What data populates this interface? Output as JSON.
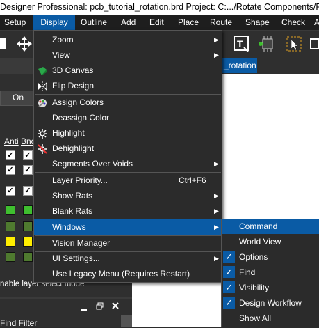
{
  "window": {
    "title": "Designer Professional: pcb_tutorial_rotation.brd  Project: C:.../Rotate Components/PCB F"
  },
  "menubar": {
    "items": [
      "Setup",
      "Display",
      "Outline",
      "Add",
      "Edit",
      "Place",
      "Route",
      "Shape",
      "Check",
      "A"
    ],
    "active": "Display"
  },
  "tabs": {
    "document": "_rotation"
  },
  "left_panel": {
    "on_label": "On",
    "col1": "Anti",
    "col2": "Bnd",
    "enable_layer_text": "nable layer select mode",
    "find_filter": "Find Filter"
  },
  "display_menu": {
    "items": [
      {
        "label": "Zoom",
        "submenu": true
      },
      {
        "label": "View",
        "submenu": true
      },
      {
        "label": "3D Canvas",
        "icon": "3d-canvas-icon"
      },
      {
        "label": "Flip Design",
        "icon": "flip-design-icon"
      },
      {
        "label": "Assign Colors",
        "icon": "assign-colors-icon"
      },
      {
        "label": "Deassign Color"
      },
      {
        "label": "Highlight",
        "icon": "highlight-icon"
      },
      {
        "label": "Dehighlight",
        "icon": "dehighlight-icon"
      },
      {
        "label": "Segments Over Voids",
        "submenu": true
      },
      {
        "label": "Layer Priority...",
        "shortcut": "Ctrl+F6"
      },
      {
        "label": "Show Rats",
        "submenu": true
      },
      {
        "label": "Blank Rats",
        "submenu": true
      },
      {
        "label": "Windows",
        "submenu": true,
        "highlighted": true
      },
      {
        "label": "Vision Manager"
      },
      {
        "label": "UI Settings...",
        "submenu": true
      },
      {
        "label": "Use Legacy Menu (Requires Restart)"
      }
    ]
  },
  "windows_submenu": {
    "items": [
      {
        "label": "Command",
        "checked": false,
        "highlighted": true
      },
      {
        "label": "World View",
        "checked": false
      },
      {
        "label": "Options",
        "checked": true
      },
      {
        "label": "Find",
        "checked": true
      },
      {
        "label": "Visibility",
        "checked": true
      },
      {
        "label": "Design Workflow",
        "checked": true
      },
      {
        "label": "Show All",
        "checked": false
      }
    ]
  },
  "colors": {
    "menu_bg": "#2b2b2b",
    "highlight": "#0a5ba5",
    "green_swatch": "#3fbf2f",
    "olive_swatch": "#4f7a2f",
    "yellow_swatch": "#ffee00"
  }
}
